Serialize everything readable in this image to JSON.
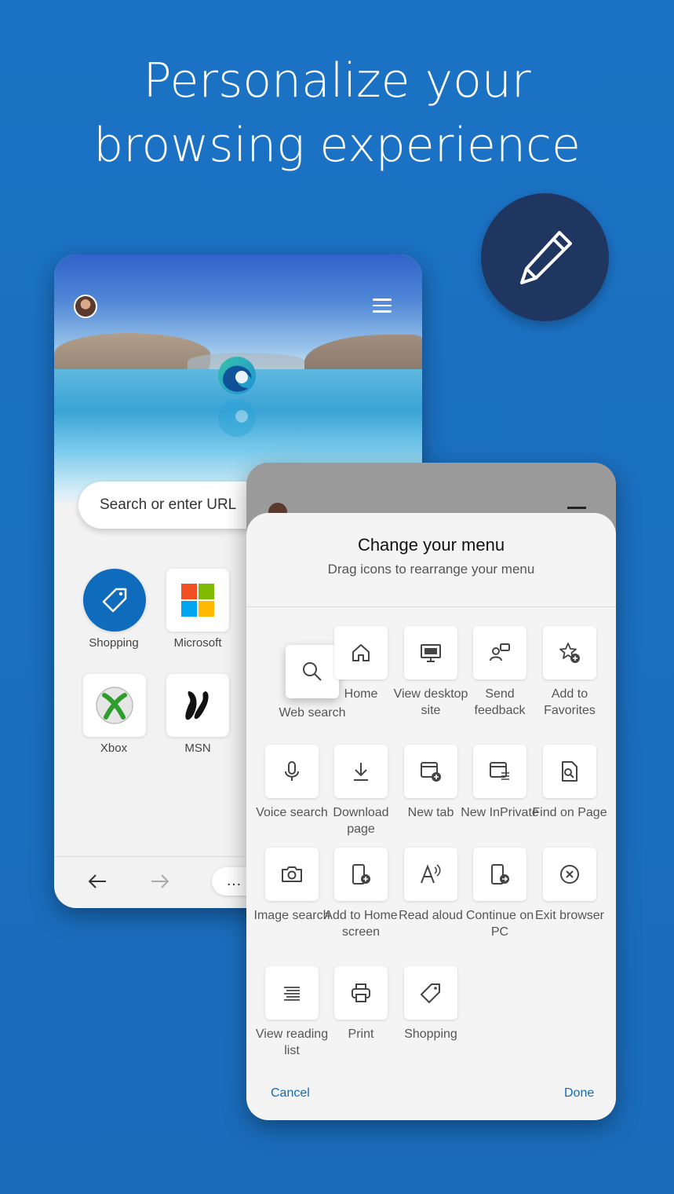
{
  "headline": {
    "line1": "Personalize your",
    "line2": "browsing experience"
  },
  "badge_icon": "pencil-icon",
  "browser": {
    "search_placeholder": "Search or enter URL",
    "top_sites": [
      {
        "label": "Shopping",
        "icon": "tag-icon"
      },
      {
        "label": "Microsoft",
        "icon": "microsoft-logo"
      },
      {
        "label": "Xbox",
        "icon": "xbox-logo"
      },
      {
        "label": "MSN",
        "icon": "msn-logo"
      }
    ],
    "more_label": "…"
  },
  "menu_sheet": {
    "title": "Change your menu",
    "subtitle": "Drag icons to rearrange your menu",
    "items": [
      {
        "label": "Web search",
        "icon": "search-icon"
      },
      {
        "label": "Home",
        "icon": "home-icon"
      },
      {
        "label": "View desktop site",
        "icon": "desktop-icon"
      },
      {
        "label": "Send feedback",
        "icon": "feedback-icon"
      },
      {
        "label": "Add to Favorites",
        "icon": "star-add-icon"
      },
      {
        "label": "Voice search",
        "icon": "microphone-icon"
      },
      {
        "label": "Download page",
        "icon": "download-icon"
      },
      {
        "label": "New tab",
        "icon": "new-tab-icon"
      },
      {
        "label": "New InPrivate",
        "icon": "inprivate-icon"
      },
      {
        "label": "Find on Page",
        "icon": "find-page-icon"
      },
      {
        "label": "Image search",
        "icon": "camera-icon"
      },
      {
        "label": "Add to Home screen",
        "icon": "add-phone-icon"
      },
      {
        "label": "Read aloud",
        "icon": "read-aloud-icon"
      },
      {
        "label": "Continue on PC",
        "icon": "continue-pc-icon"
      },
      {
        "label": "Exit browser",
        "icon": "close-circle-icon"
      },
      {
        "label": "View reading list",
        "icon": "reading-list-icon"
      },
      {
        "label": "Print",
        "icon": "print-icon"
      },
      {
        "label": "Shopping",
        "icon": "tag-icon"
      }
    ],
    "cancel_label": "Cancel",
    "done_label": "Done"
  },
  "colors": {
    "background": "#1a6fc0",
    "badge": "#1f3661",
    "accent": "#0f6cbd"
  }
}
